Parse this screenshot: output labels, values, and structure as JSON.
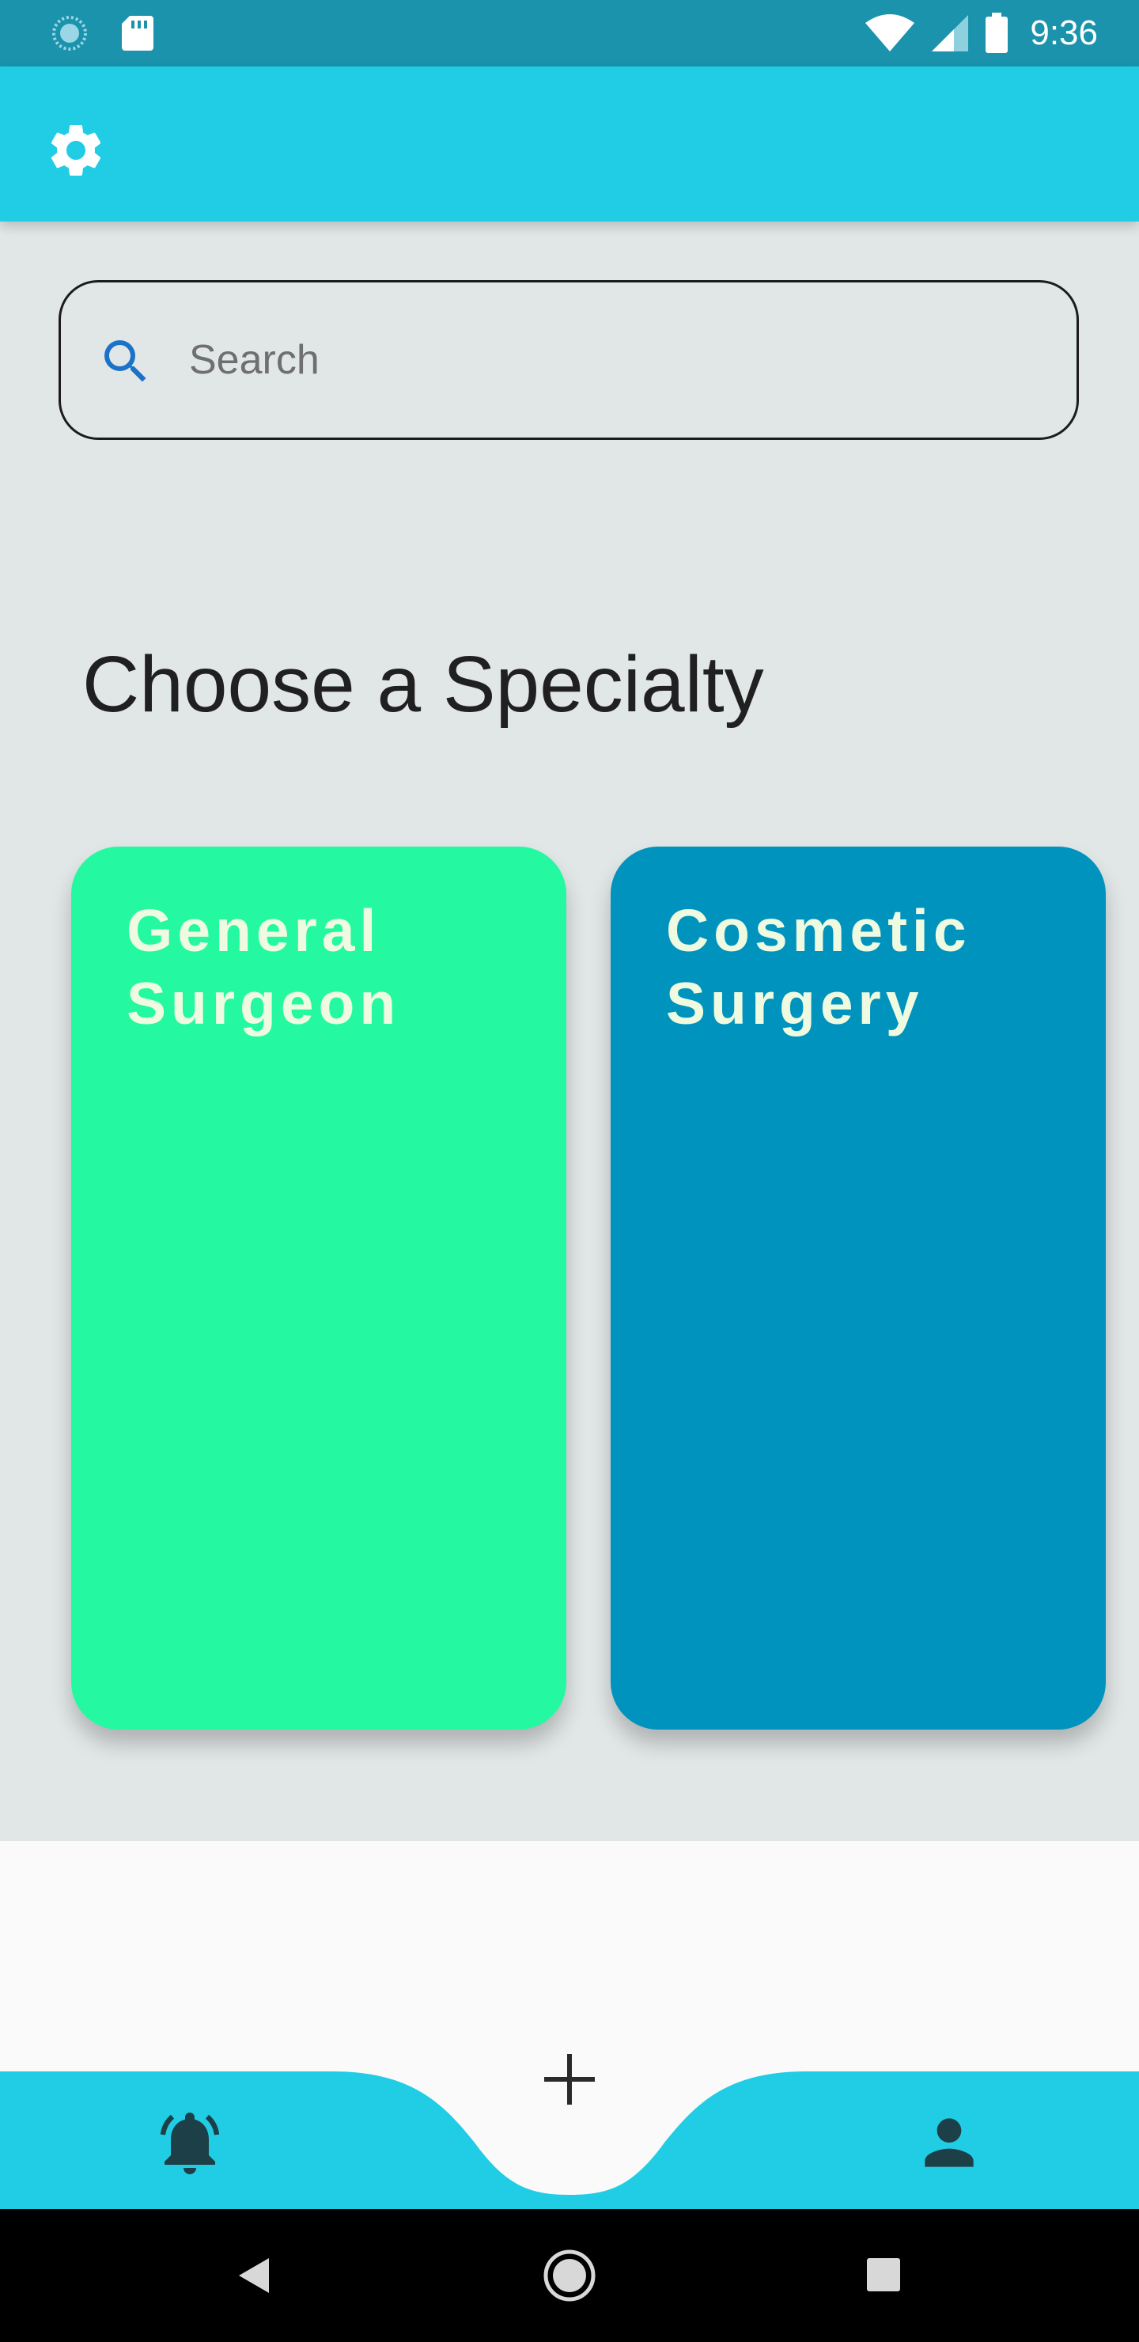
{
  "status_bar": {
    "time": "9:36",
    "icons": [
      "sync-icon",
      "sd-card-icon",
      "wifi-icon",
      "signal-icon",
      "battery-icon"
    ]
  },
  "app_bar": {
    "settings_icon": "gear-icon"
  },
  "search": {
    "placeholder": "Search",
    "value": ""
  },
  "main": {
    "title": "Choose a Specialty",
    "cards": [
      {
        "label": "General\nSurgeon",
        "color": "#24f9a2"
      },
      {
        "label": "Cosmetic\nSurgery",
        "color": "#0093bd"
      }
    ]
  },
  "bottom_nav": {
    "items": [
      "bell-icon",
      "plus-icon",
      "person-icon"
    ],
    "accent": "#20cde4"
  },
  "system_nav": {
    "items": [
      "back-icon",
      "home-icon",
      "recents-icon"
    ]
  }
}
